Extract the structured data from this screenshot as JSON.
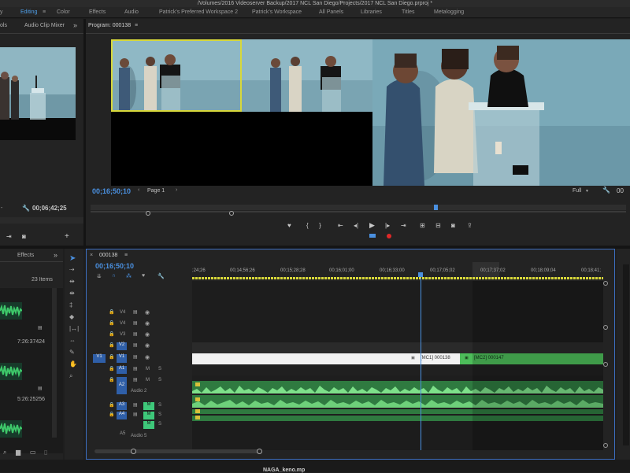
{
  "titlebar": "/Volumes/2016 Videoserver Backup/2017 NCL San Diego/Projects/2017 NCL San Diego.prproj *",
  "workspaces": [
    {
      "label": "y",
      "active": false
    },
    {
      "label": "Editing",
      "active": true
    },
    {
      "label": "Color",
      "active": false
    },
    {
      "label": "Effects",
      "active": false
    },
    {
      "label": "Audio",
      "active": false
    },
    {
      "label": "Patrick's Preferred Workspace 2",
      "active": false
    },
    {
      "label": "Patrick's Workspace",
      "active": false
    },
    {
      "label": "All Panels",
      "active": false
    },
    {
      "label": "Libraries",
      "active": false
    },
    {
      "label": "Titles",
      "active": false
    },
    {
      "label": "Metalogging",
      "active": false
    }
  ],
  "source": {
    "tab_fragment": "ols",
    "tab_audio_mixer": "Audio Clip Mixer",
    "chevron": "»",
    "timecode": "00;06;42;25"
  },
  "program": {
    "title": "Program: 000138",
    "menu": "≡",
    "timecode": "00;16;50;10",
    "page": "Page 1",
    "resolution": "Full",
    "end_fragment": "00"
  },
  "project": {
    "effects_tab": "Effects",
    "chevron": "»",
    "items_count": "23 Items",
    "durations": [
      "7:26:37424",
      "5:26:25256"
    ]
  },
  "timeline": {
    "tab": "000138",
    "menu": "≡",
    "close": "×",
    "timecode": "00;16;50;10",
    "ruler": [
      ";24;26",
      "00;14;56;26",
      "00;15;28;28",
      "00;16;01;00",
      "00;16;33;00",
      "00;17;05;02",
      "00;17;37;02",
      "00;18;09;04",
      "00;18;41;"
    ],
    "video_tracks": [
      "V4",
      "V4",
      "V3",
      "V2",
      "V1"
    ],
    "source_patch": "V1",
    "audio_tracks": [
      "A1",
      "A2",
      "A3",
      "A4",
      "A5"
    ],
    "audio2_name": "Audio 2",
    "audio5_name": "Audio 5",
    "mute": "M",
    "solo": "S",
    "clip1": "[MC1] 000138",
    "clip2": "[MC2] 000147"
  },
  "bottom_text": "NAGA_keno.mp"
}
